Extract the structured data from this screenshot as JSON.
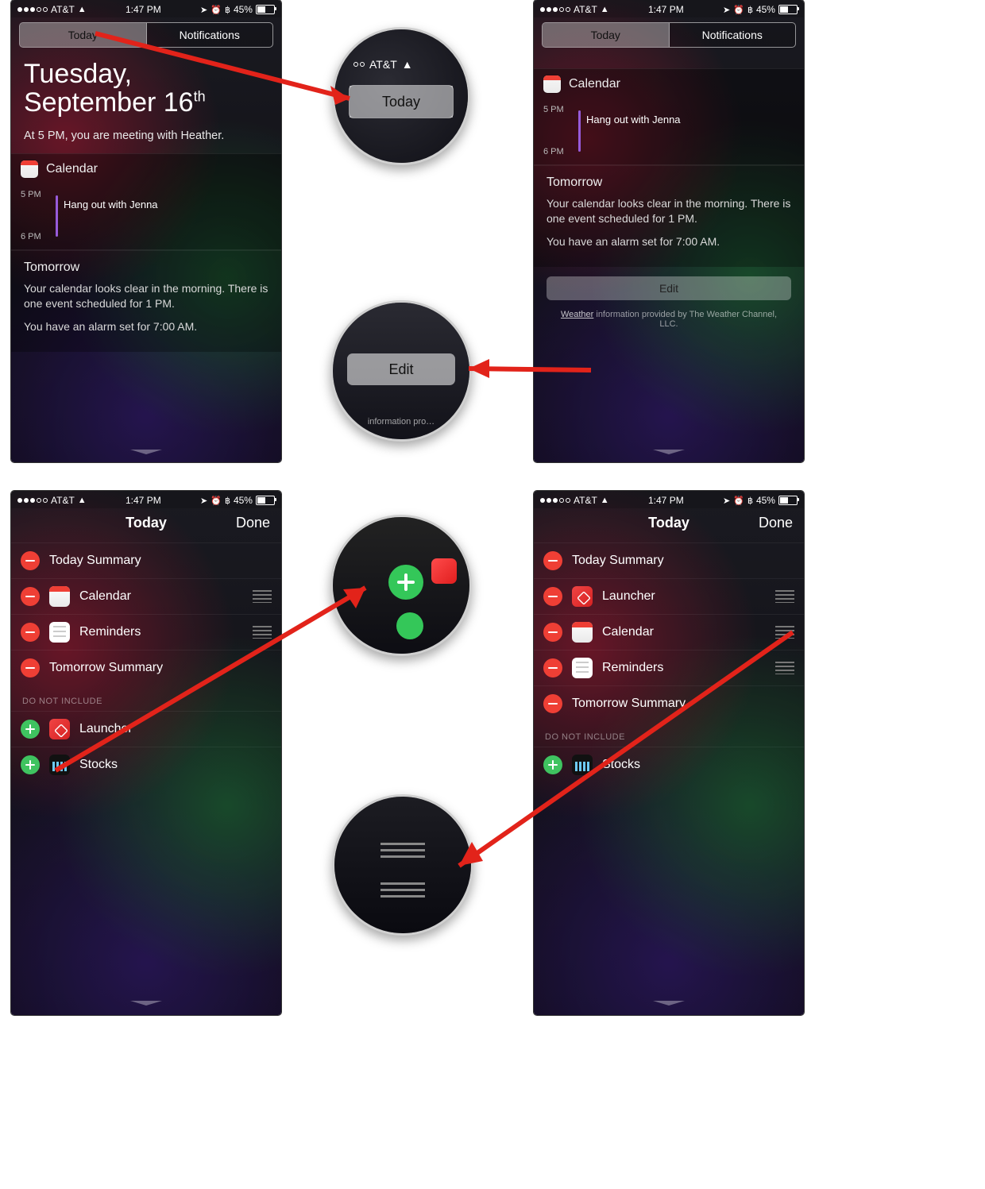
{
  "status": {
    "carrier": "AT&T",
    "time": "1:47 PM",
    "battery_text": "45%"
  },
  "tabs": {
    "today": "Today",
    "notifications": "Notifications"
  },
  "screen1": {
    "date_line1": "Tuesday,",
    "date_line2_prefix": "September 16",
    "date_line2_suffix": "th",
    "lead": "At 5 PM, you are meeting with Heather.",
    "calendar_title": "Calendar",
    "hour_top": "5 PM",
    "hour_bottom": "6 PM",
    "event_title": "Hang out with Jenna",
    "tomorrow_heading": "Tomorrow",
    "tomorrow_body": "Your calendar looks clear in the morning. There is one event scheduled for 1 PM.",
    "alarm_line": "You have an alarm set for 7:00 AM."
  },
  "screen2": {
    "edit_label": "Edit",
    "foot_prefix": "Weather",
    "foot_rest": " information provided by The Weather Channel, LLC."
  },
  "editHeader": {
    "title": "Today",
    "done": "Done"
  },
  "screen3": {
    "include": [
      {
        "label": "Today Summary",
        "icon": null,
        "grip": false
      },
      {
        "label": "Calendar",
        "icon": "cal",
        "grip": true
      },
      {
        "label": "Reminders",
        "icon": "rem",
        "grip": true
      },
      {
        "label": "Tomorrow Summary",
        "icon": null,
        "grip": false
      }
    ],
    "exclude_label": "DO NOT INCLUDE",
    "exclude": [
      {
        "label": "Launcher",
        "icon": "launcher"
      },
      {
        "label": "Stocks",
        "icon": "stocks"
      }
    ]
  },
  "screen4": {
    "include": [
      {
        "label": "Today Summary",
        "icon": null,
        "grip": false
      },
      {
        "label": "Launcher",
        "icon": "launcher",
        "grip": true
      },
      {
        "label": "Calendar",
        "icon": "cal",
        "grip": true
      },
      {
        "label": "Reminders",
        "icon": "rem",
        "grip": true
      },
      {
        "label": "Tomorrow Summary",
        "icon": null,
        "grip": false
      }
    ],
    "exclude_label": "DO NOT INCLUDE",
    "exclude": [
      {
        "label": "Stocks",
        "icon": "stocks"
      }
    ]
  },
  "mag": {
    "today": "Today",
    "edit": "Edit",
    "foot_frag": "information pro…"
  }
}
